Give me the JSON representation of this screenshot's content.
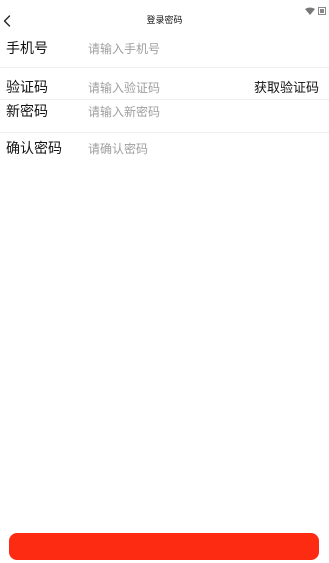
{
  "nav": {
    "title": "登录密码"
  },
  "form": {
    "phone": {
      "label": "手机号",
      "placeholder": "请输入手机号",
      "value": ""
    },
    "code": {
      "label": "验证码",
      "placeholder": "请输入验证码",
      "value": "",
      "get_code_label": "获取验证码"
    },
    "new_password": {
      "label": "新密码",
      "placeholder": "请输入新密码",
      "value": ""
    },
    "confirm_password": {
      "label": "确认密码",
      "placeholder": "请确认密码",
      "value": ""
    }
  },
  "submit": {
    "label": "",
    "color": "#fd2b12"
  },
  "icons": {
    "status": [
      "wifi-icon",
      "battery-icon"
    ],
    "back": "chevron-left-icon"
  }
}
